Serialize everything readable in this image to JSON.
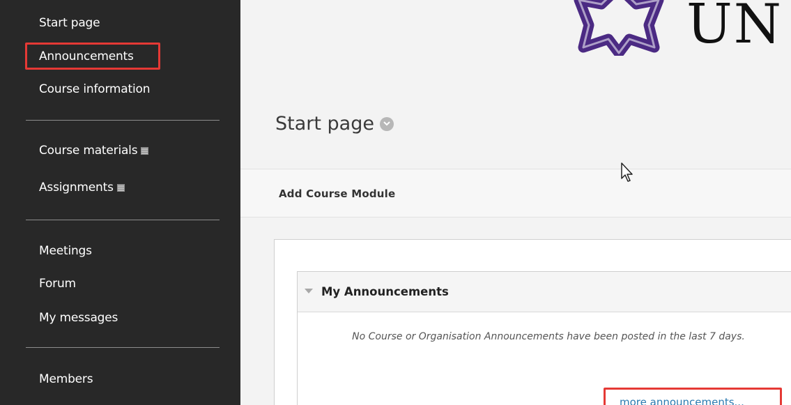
{
  "sidebar": {
    "items": [
      {
        "label": "Start page"
      },
      {
        "label": "Announcements"
      },
      {
        "label": "Course information"
      },
      {
        "label": "Course materials"
      },
      {
        "label": "Assignments"
      },
      {
        "label": "Meetings"
      },
      {
        "label": "Forum"
      },
      {
        "label": "My messages"
      },
      {
        "label": "Members"
      }
    ]
  },
  "header": {
    "logo_text": "UN"
  },
  "page": {
    "title": "Start page"
  },
  "toolbar": {
    "add_module_label": "Add Course Module"
  },
  "module": {
    "title": "My Announcements",
    "message": "No Course or Organisation Announcements have been posted in the last 7 days.",
    "more_link": "more announcements..."
  },
  "colors": {
    "sidebar_bg": "#282828",
    "highlight": "#e53935",
    "logo_purple": "#4b2a83",
    "link": "#2a7ab0"
  }
}
